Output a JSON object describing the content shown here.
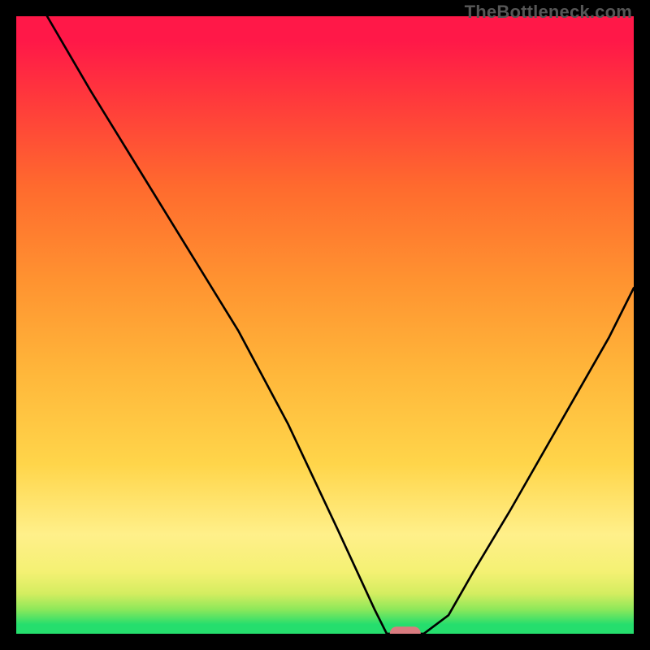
{
  "watermark": "TheBottleneck.com",
  "chart_data": {
    "type": "line",
    "title": "",
    "xlabel": "",
    "ylabel": "",
    "xlim": [
      0,
      100
    ],
    "ylim": [
      0,
      100
    ],
    "grid": false,
    "legend": false,
    "gradient_bands": [
      {
        "y0": 0,
        "y1": 3,
        "color": "#25de6d"
      },
      {
        "y0": 3,
        "y1": 5,
        "color": "#8fe85a"
      },
      {
        "y0": 5,
        "y1": 8,
        "color": "#d4ed60"
      },
      {
        "y0": 8,
        "y1": 12,
        "color": "#f4f173"
      },
      {
        "y0": 12,
        "y1": 20,
        "color": "#fff08a"
      },
      {
        "y0": 20,
        "y1": 35,
        "color": "#ffd54a"
      },
      {
        "y0": 35,
        "y1": 50,
        "color": "#ffb63a"
      },
      {
        "y0": 50,
        "y1": 65,
        "color": "#ff9230"
      },
      {
        "y0": 65,
        "y1": 80,
        "color": "#ff6a2e"
      },
      {
        "y0": 80,
        "y1": 92,
        "color": "#ff3b3b"
      },
      {
        "y0": 92,
        "y1": 100,
        "color": "#ff1848"
      }
    ],
    "series": [
      {
        "name": "bottleneck-curve",
        "x": [
          5,
          12,
          20,
          28,
          36,
          44,
          52,
          58,
          60,
          62,
          66,
          70,
          74,
          80,
          88,
          96,
          100
        ],
        "y": [
          100,
          88,
          75,
          62,
          49,
          34,
          17,
          4,
          0,
          0,
          0,
          3,
          10,
          20,
          34,
          48,
          56
        ]
      }
    ],
    "marker": {
      "name": "selected-point",
      "x": 63,
      "y": 0,
      "width": 5,
      "height": 2.3,
      "color": "#d97b7f"
    }
  }
}
